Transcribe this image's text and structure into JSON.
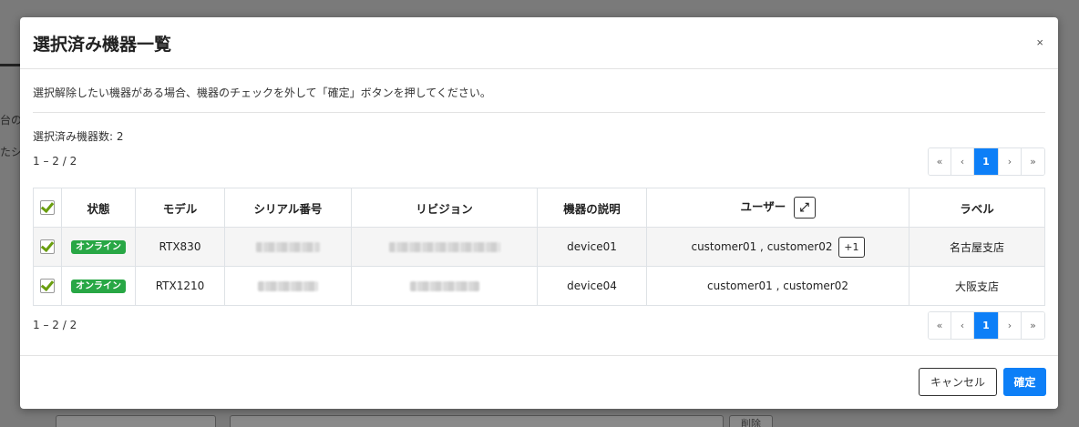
{
  "background": {
    "fragment_1": "台の",
    "fragment_2": "たシ",
    "delete_label": "削除"
  },
  "modal": {
    "title": "選択済み機器一覧",
    "close_label": "×",
    "notice": "選択解除したい機器がある場合、機器のチェックを外して「確定」ボタンを押してください。",
    "selected_count": "選択済み機器数: 2",
    "range_top": "1 – 2 / 2",
    "range_bottom": "1 – 2 / 2",
    "pagination": {
      "first": "«",
      "prev": "‹",
      "current": "1",
      "next": "›",
      "last": "»"
    },
    "table": {
      "headers": {
        "status": "状態",
        "model": "モデル",
        "serial": "シリアル番号",
        "revision": "リビジョン",
        "description": "機器の説明",
        "user": "ユーザー",
        "label": "ラベル"
      },
      "rows": [
        {
          "status": "オンライン",
          "model": "RTX830",
          "description": "device01",
          "users": "customer01 , customer02",
          "more": "+1",
          "label": "名古屋支店"
        },
        {
          "status": "オンライン",
          "model": "RTX1210",
          "description": "device04",
          "users": "customer01 , customer02",
          "label": "大阪支店"
        }
      ]
    },
    "footer": {
      "cancel": "キャンセル",
      "confirm": "確定"
    }
  },
  "colors": {
    "primary": "#0d7ff7",
    "online_badge": "#28a745",
    "check": "#6a9e0f"
  }
}
